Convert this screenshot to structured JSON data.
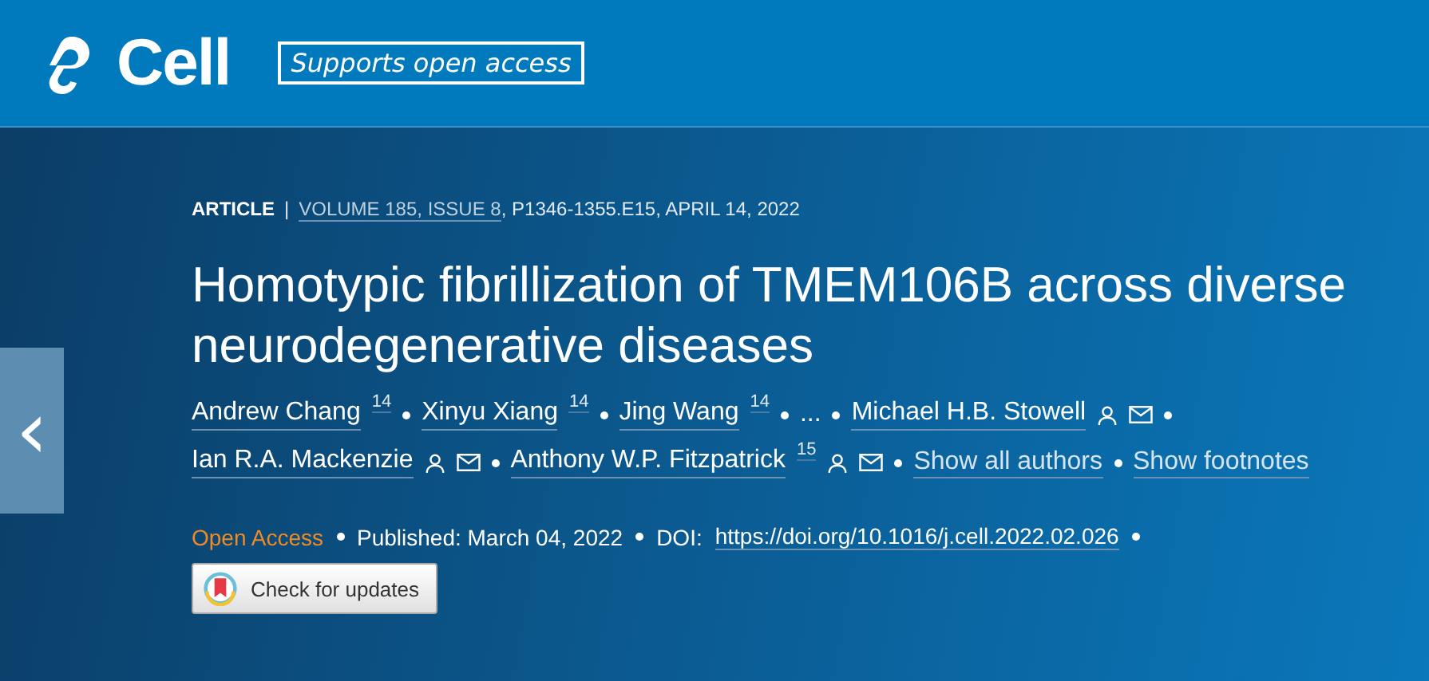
{
  "header": {
    "logo_text": "Cell",
    "badge": "Supports open access"
  },
  "nav": {
    "prev_arrow": "‹"
  },
  "meta": {
    "type": "ARTICLE",
    "separator": "|",
    "volume_link": "VOLUME 185, ISSUE 8",
    "rest": ", P1346-1355.E15, APRIL 14, 2022"
  },
  "title": "Homotypic fibrillization of TMEM106B across diverse neurodegenerative diseases",
  "author_rows": [
    [
      {
        "kind": "author",
        "name": "Andrew Chang",
        "sup": "14",
        "person": false,
        "mail": false
      },
      {
        "kind": "author",
        "name": "Xinyu Xiang",
        "sup": "14",
        "person": false,
        "mail": false
      },
      {
        "kind": "author",
        "name": "Jing Wang",
        "sup": "14",
        "person": false,
        "mail": false
      },
      {
        "kind": "ellipsis",
        "text": "..."
      },
      {
        "kind": "author",
        "name": "Michael H.B. Stowell",
        "person": true,
        "mail": true
      }
    ],
    [
      {
        "kind": "author",
        "name": "Ian R.A. Mackenzie",
        "person": true,
        "mail": true
      },
      {
        "kind": "author",
        "name": "Anthony W.P. Fitzpatrick",
        "sup": "15",
        "person": true,
        "mail": true
      },
      {
        "kind": "link",
        "text": "Show all authors"
      },
      {
        "kind": "link",
        "text": "Show footnotes"
      }
    ]
  ],
  "publication": {
    "access": "Open Access",
    "published": "Published: March 04, 2022",
    "doi_label": "DOI:",
    "doi": "https://doi.org/10.1016/j.cell.2022.02.026"
  },
  "check_button": "Check for updates"
}
